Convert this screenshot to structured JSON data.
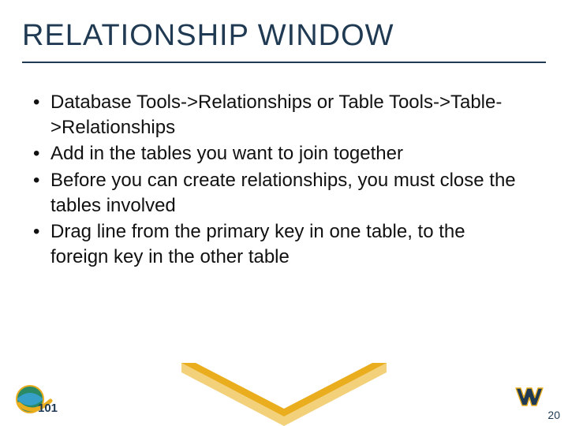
{
  "title": "RELATIONSHIP WINDOW",
  "bullets": [
    "Database Tools->Relationships or Table Tools->Table->Relationships",
    "Add in the tables you want to join together",
    "Before you can create relationships, you must close the tables involved",
    "Drag line from the primary key in one table, to the foreign key in the other table"
  ],
  "page_number": "20",
  "icons": {
    "e101": "e101-globe-icon",
    "wv": "wv-flying-logo"
  },
  "colors": {
    "title": "#1f3a52",
    "chevron": "#e9ad1e"
  }
}
